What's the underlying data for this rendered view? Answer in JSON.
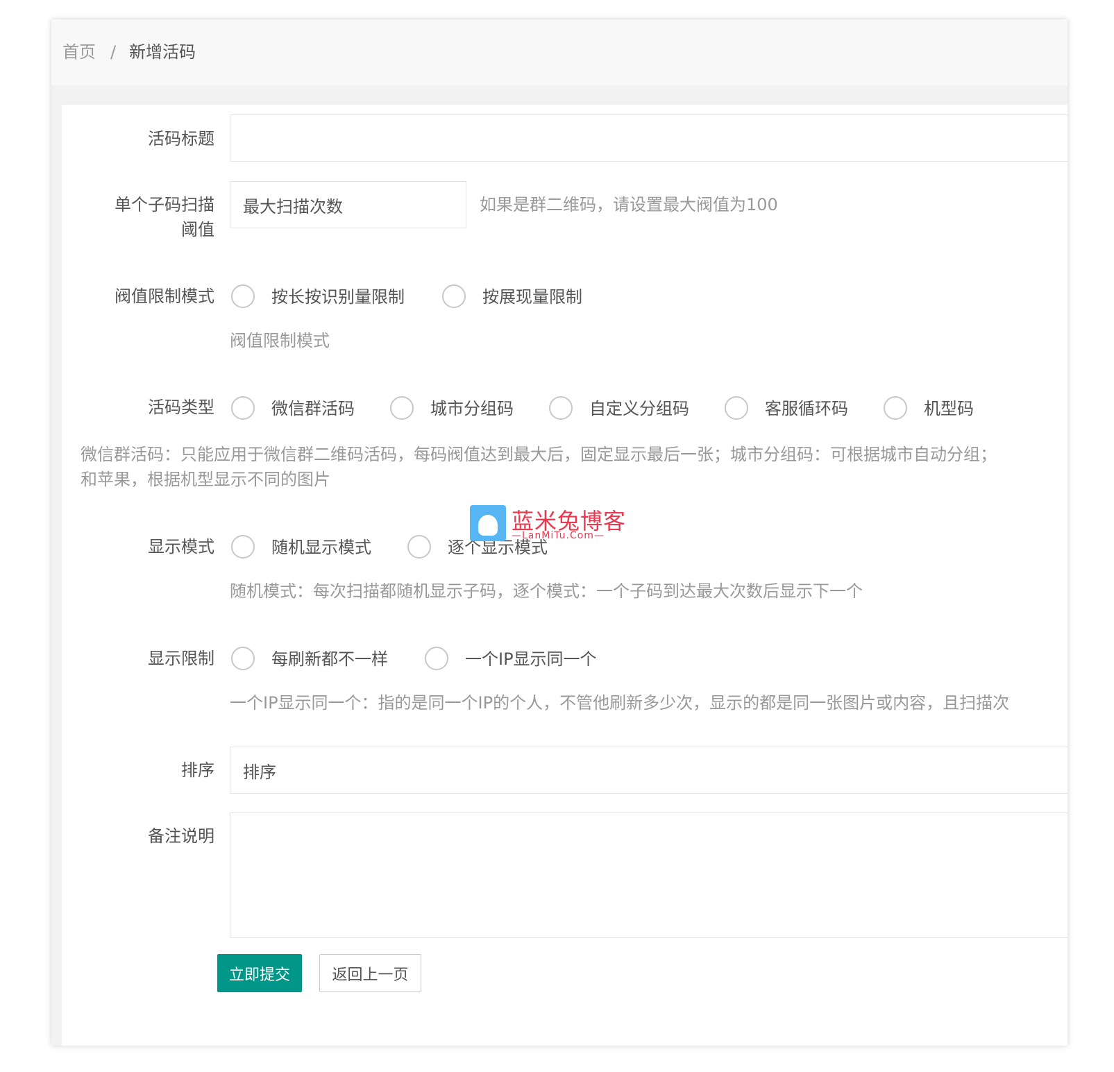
{
  "breadcrumb": {
    "home": "首页",
    "separator": "/",
    "current": "新增活码"
  },
  "form": {
    "title_label": "活码标题",
    "title_value": "",
    "threshold_label_line1": "单个子码扫描",
    "threshold_label_line2": "阈值",
    "threshold_placeholder": "最大扫描次数",
    "threshold_tip": "如果是群二维码，请设置最大阀值为100",
    "limit_mode_label": "阀值限制模式",
    "limit_mode_options": [
      "按长按识别量限制",
      "按展现量限制"
    ],
    "limit_mode_tip": "阀值限制模式",
    "code_type_label": "活码类型",
    "code_type_options": [
      "微信群活码",
      "城市分组码",
      "自定义分组码",
      "客服循环码",
      "机型码"
    ],
    "code_type_tip_line1": "微信群活码：只能应用于微信群二维码活码，每码阀值达到最大后，固定显示最后一张；城市分组码：可根据城市自动分组；",
    "code_type_tip_line2": "和苹果，根据机型显示不同的图片",
    "display_mode_label": "显示模式",
    "display_mode_options": [
      "随机显示模式",
      "逐个显示模式"
    ],
    "display_mode_tip": "随机模式：每次扫描都随机显示子码，逐个模式：一个子码到达最大次数后显示下一个",
    "display_limit_label": "显示限制",
    "display_limit_options": [
      "每刷新都不一样",
      "一个IP显示同一个"
    ],
    "display_limit_tip": "一个IP显示同一个：指的是同一个IP的个人，不管他刷新多少次，显示的都是同一张图片或内容，且扫描次",
    "sort_label": "排序",
    "sort_placeholder": "排序",
    "remark_label": "备注说明",
    "remark_value": ""
  },
  "buttons": {
    "submit": "立即提交",
    "back": "返回上一页"
  },
  "watermark": {
    "title": "蓝米兔博客",
    "subtitle": "—LanMiTu.Com—"
  },
  "colors": {
    "primary": "#009688",
    "watermark": "#e8394e"
  }
}
